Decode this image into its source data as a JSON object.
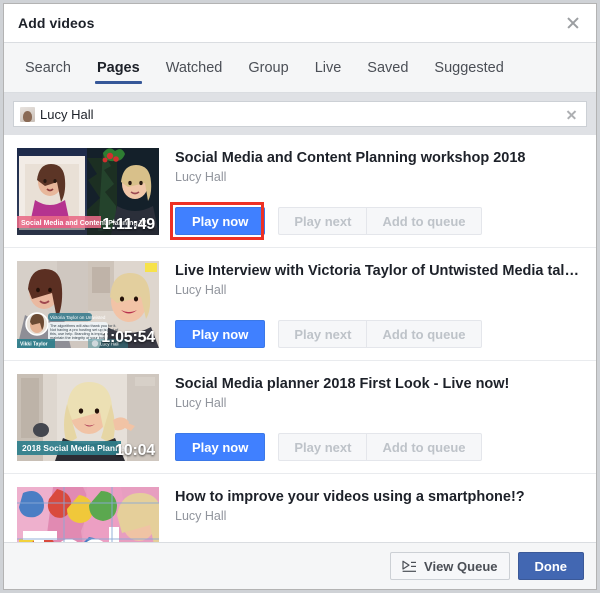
{
  "dialog": {
    "title": "Add videos",
    "close_icon": "close-icon"
  },
  "tabs": [
    {
      "label": "Search",
      "active": false
    },
    {
      "label": "Pages",
      "active": true
    },
    {
      "label": "Watched",
      "active": false
    },
    {
      "label": "Group",
      "active": false
    },
    {
      "label": "Live",
      "active": false
    },
    {
      "label": "Saved",
      "active": false
    },
    {
      "label": "Suggested",
      "active": false
    }
  ],
  "search": {
    "value": "Lucy Hall",
    "placeholder": "Search",
    "avatar_icon": "page-avatar-icon",
    "clear_icon": "clear-icon"
  },
  "buttons": {
    "play_now": "Play now",
    "play_next": "Play next",
    "add_to_queue": "Add to queue"
  },
  "videos": [
    {
      "title": "Social Media and Content Planning workshop 2018",
      "author": "Lucy Hall",
      "duration": "1:11:49",
      "has_buttons": true,
      "highlighted": true,
      "thumb": "two-women-christmas-split"
    },
    {
      "title": "Live Interview with Victoria Taylor of Untwisted Media talki…",
      "author": "Lucy Hall",
      "duration": "1:05:54",
      "has_buttons": true,
      "highlighted": false,
      "thumb": "two-women-interview-split"
    },
    {
      "title": "Social Media planner 2018 First Look - Live now!",
      "author": "Lucy Hall",
      "duration": "10:04",
      "has_buttons": true,
      "highlighted": false,
      "thumb": "blonde-woman-pointing"
    },
    {
      "title": "How to improve your videos using a smartphone!?",
      "author": "Lucy Hall",
      "duration": "",
      "has_buttons": false,
      "highlighted": false,
      "thumb": "graffiti-wall-woman"
    }
  ],
  "footer": {
    "view_queue": "View Queue",
    "queue_icon": "play-list-icon",
    "done": "Done"
  },
  "colors": {
    "accent_blue": "#4080ff",
    "done_blue": "#4267b2",
    "tab_underline": "#365899",
    "highlight_red": "#ee3124",
    "title_text": "#1d2129",
    "muted_text": "#90949c"
  }
}
